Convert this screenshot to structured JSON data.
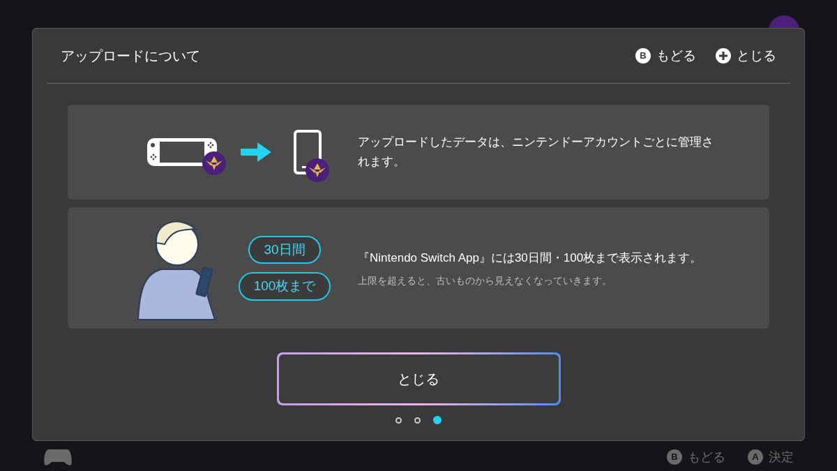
{
  "background": {
    "footer_hints": [
      {
        "key": "B",
        "label": "もどる"
      },
      {
        "key": "A",
        "label": "決定"
      }
    ]
  },
  "dialog": {
    "title": "アップロードについて",
    "header_actions": [
      {
        "kind": "key",
        "key": "B",
        "label": "もどる"
      },
      {
        "kind": "plus",
        "label": "とじる"
      }
    ],
    "panels": [
      {
        "kind": "transfer",
        "text": "アップロードしたデータは、ニンテンドーアカウントごとに管理されます。"
      },
      {
        "kind": "limits",
        "badges": [
          "30日間",
          "100枚まで"
        ],
        "text": "『Nintendo Switch App』には30日間・100枚まで表示されます。",
        "note": "上限を超えると、古いものから見えなくなっていきます。"
      }
    ],
    "button": "とじる",
    "pages": [
      {
        "selected": false
      },
      {
        "selected": false
      },
      {
        "selected": true
      }
    ]
  }
}
